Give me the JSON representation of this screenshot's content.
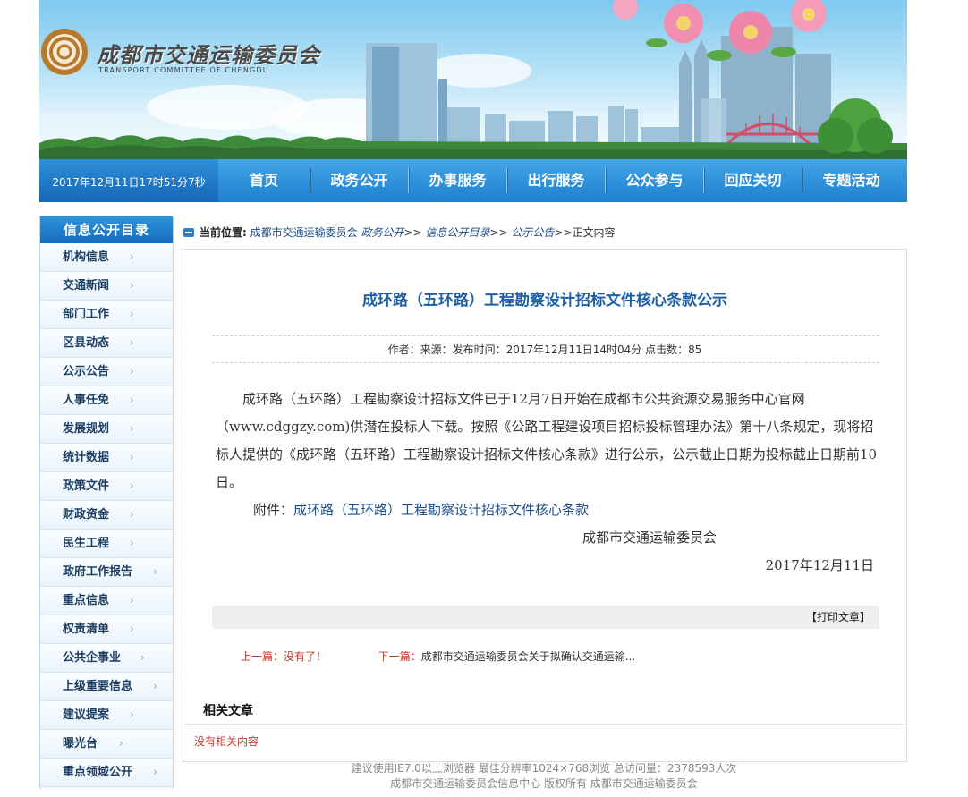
{
  "header": {
    "org_name_cn": "成都市交通运输委员会",
    "org_name_en": "TRANSPORT COMMITTEE OF CHENGDU"
  },
  "nav": {
    "datetime": "2017年12月11日17时51分7秒",
    "items": [
      "首页",
      "政务公开",
      "办事服务",
      "出行服务",
      "公众参与",
      "回应关切",
      "专题活动"
    ]
  },
  "sidebar": {
    "title": "信息公开目录",
    "arrow": "›",
    "items": [
      "机构信息",
      "交通新闻",
      "部门工作",
      "区县动态",
      "公示公告",
      "人事任免",
      "发展规划",
      "统计数据",
      "政策文件",
      "财政资金",
      "民生工程",
      "政府工作报告",
      "重点信息",
      "权责清单",
      "公共企事业",
      "上级重要信息",
      "建议提案",
      "曝光台",
      "重点领域公开"
    ]
  },
  "breadcrumb": {
    "label": "当前位置:",
    "home": "成都市交通运输委员会",
    "level1": "政务公开",
    "sep": ">>",
    "level2": "信息公开目录",
    "level3": "公示公告",
    "current": "正文内容"
  },
  "article": {
    "title": "成环路（五环路）工程勘察设计招标文件核心条款公示",
    "meta": "作者：来源：发布时间：2017年12月11日14时04分 点击数：85",
    "body": "成环路（五环路）工程勘察设计招标文件已于12月7日开始在成都市公共资源交易服务中心官网（www.cdggzy.com)供潜在投标人下载。按照《公路工程建设项目招标投标管理办法》第十八条规定，现将招标人提供的《成环路（五环路）工程勘察设计招标文件核心条款》进行公示，公示截止日期为投标截止日期前10日。",
    "attachment_label": "附件：",
    "attachment_link": "成环路（五环路）工程勘察设计招标文件核心条款",
    "signer": "成都市交通运输委员会",
    "sign_date": "2017年12月11日",
    "print": "【打印文章】",
    "prev_label": "上一篇：",
    "prev_value": "没有了！",
    "next_label": "下一篇：",
    "next_value": "成都市交通运输委员会关于拟确认交通运输..."
  },
  "related": {
    "title": "相关文章",
    "empty": "没有相关内容"
  },
  "footer": {
    "line1": "建议使用IE7.0以上浏览器 最佳分辨率1024×768浏览 总访问量：2378593人次",
    "line2": "成都市交通运输委员会信息中心 版权所有 成都市交通运输委员会"
  },
  "colors": {
    "nav_blue": "#1e80cf",
    "title_blue": "#1d5fa5",
    "link_red": "#c0392b"
  }
}
